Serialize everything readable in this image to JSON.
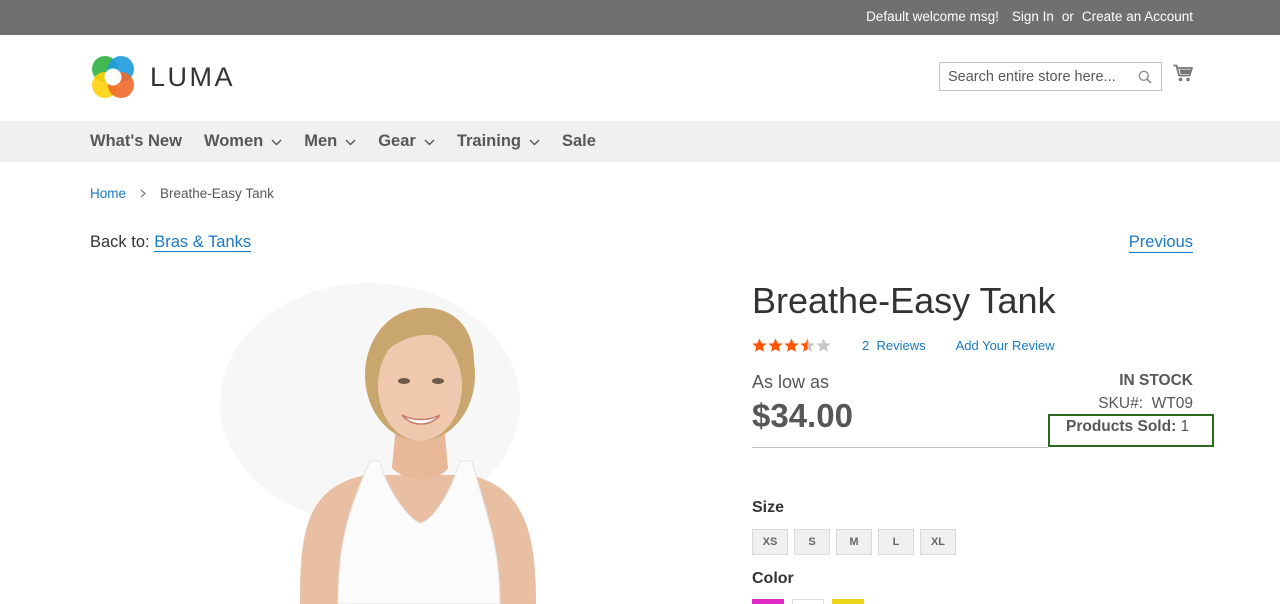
{
  "topbar": {
    "welcome": "Default welcome msg!",
    "sign_in": "Sign In",
    "or": "or",
    "create_account": "Create an Account"
  },
  "header": {
    "logo_text": "LUMA",
    "search_placeholder": "Search entire store here..."
  },
  "nav": {
    "items": [
      {
        "label": "What's New",
        "has_dropdown": false
      },
      {
        "label": "Women",
        "has_dropdown": true
      },
      {
        "label": "Men",
        "has_dropdown": true
      },
      {
        "label": "Gear",
        "has_dropdown": true
      },
      {
        "label": "Training",
        "has_dropdown": true
      },
      {
        "label": "Sale",
        "has_dropdown": false
      }
    ]
  },
  "breadcrumb": {
    "home": "Home",
    "current": "Breathe-Easy Tank"
  },
  "back": {
    "prefix": "Back to:",
    "link": "Bras & Tanks",
    "previous": "Previous"
  },
  "product": {
    "title": "Breathe-Easy Tank",
    "rating_stars": 3.5,
    "rating_max": 5,
    "reviews_count": "2",
    "reviews_label": "Reviews",
    "add_review": "Add Your Review",
    "as_low_as": "As low as",
    "price": "$34.00",
    "stock": "IN STOCK",
    "sku_label": "SKU#:",
    "sku_value": "WT09",
    "sold_label": "Products Sold:",
    "sold_value": "1",
    "size_label": "Size",
    "sizes": [
      "XS",
      "S",
      "M",
      "L",
      "XL"
    ],
    "color_label": "Color",
    "colors": [
      "#e02ac8",
      "#ffffff",
      "#ecd418"
    ]
  },
  "colors": {
    "topbar": "#6e716e",
    "link": "#1979c3",
    "nav_bg": "#f0f0f0",
    "star": "#ff5501",
    "highlight_box": "#2d6a1f"
  }
}
